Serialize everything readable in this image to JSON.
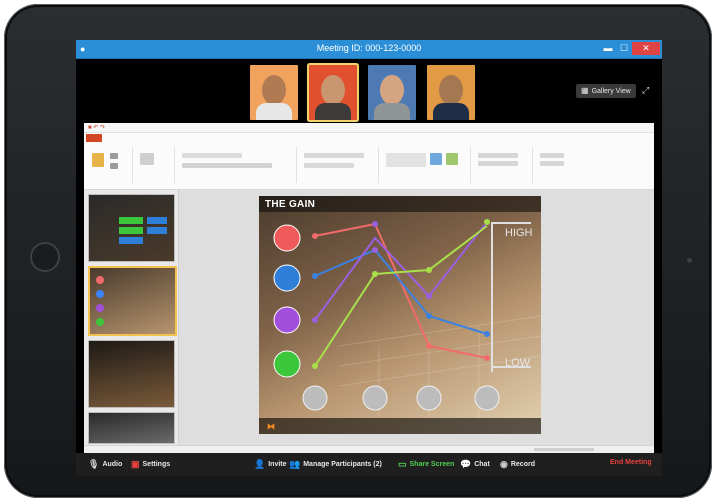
{
  "meeting": {
    "title": "Meeting ID: 000-123-0000",
    "gallery_view_label": "Gallery View"
  },
  "slide": {
    "title": "THE GAIN"
  },
  "toolbar": {
    "audio_label": "Audio",
    "settings_label": "Settings",
    "invite_label": "Invite",
    "manage_participants_label": "Manage Participants (2)",
    "share_screen_label": "Share Screen",
    "chat_label": "Chat",
    "record_label": "Record",
    "end_meeting_label": "End Meeting"
  },
  "colors": {
    "titlebar": "#2a8fd6",
    "share_green": "#51d053",
    "end_red": "#e94141",
    "slide_accent_orange": "#f08a1d"
  },
  "icons": [
    "microphone-icon",
    "video-icon",
    "settings-icon",
    "invite-icon",
    "participants-icon",
    "share-screen-icon",
    "chat-icon",
    "record-icon",
    "gallery-view-icon",
    "fullscreen-icon"
  ]
}
